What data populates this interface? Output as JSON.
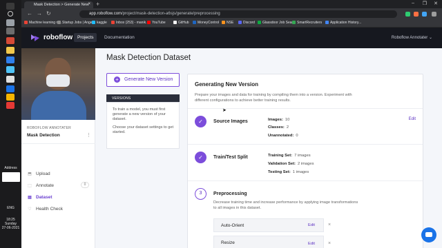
{
  "taskbar": {
    "address_label": "Address",
    "language": "ENG",
    "time": "18:25",
    "day": "Sunday",
    "date": "27-06-2021"
  },
  "browser": {
    "tab_title": "Mask Detection > Generate New",
    "url_host": "app.roboflow.com",
    "url_path": "/project/mask-detection-a6sjs/generate/preprocessing",
    "bookmarks": [
      {
        "label": "Machine learning m...",
        "color": "#ea4335"
      },
      {
        "label": "Startup Jobs | Ange...",
        "color": "#888888"
      },
      {
        "label": "kaggle",
        "color": "#20beff"
      },
      {
        "label": "Inbox (253) - manik...",
        "color": "#ea4335"
      },
      {
        "label": "YouTube",
        "color": "#ff0000"
      },
      {
        "label": "GitHub",
        "color": "#f5f5f5"
      },
      {
        "label": "MoneyControl",
        "color": "#1e66c1"
      },
      {
        "label": "NSE",
        "color": "#f7931e"
      },
      {
        "label": "Discord",
        "color": "#5865f2"
      },
      {
        "label": "Glassdoor Job Sear...",
        "color": "#0caa41"
      },
      {
        "label": "SmartRecruiters",
        "color": "#34a853"
      },
      {
        "label": "Application History...",
        "color": "#4285f4"
      }
    ]
  },
  "app": {
    "brand": "roboflow",
    "nav_projects": "Projects",
    "nav_docs": "Documentation",
    "user": "Roboflow Annotater",
    "accent": "#7c4ddb"
  },
  "sidebar": {
    "kicker": "ROBOFLOW ANNOTATER",
    "project": "Mask Detection",
    "items": [
      {
        "label": "Upload"
      },
      {
        "label": "Annotate",
        "count": "0"
      },
      {
        "label": "Dataset"
      },
      {
        "label": "Health Check"
      }
    ]
  },
  "main": {
    "title": "Mask Detection Dataset",
    "generate_button": "Generate New Version",
    "versions_header": "VERSIONS",
    "versions_p1": "To train a model, you must first generate a new version of your dataset.",
    "versions_p2": "Choose your dataset settings to get started."
  },
  "card": {
    "title": "Generating New Version",
    "description": "Prepare your images and data for training by compiling them into a version. Experiment with different configurations to achieve better training results.",
    "source": {
      "name": "Source Images",
      "edit": "Edit",
      "images_label": "Images:",
      "images": "10",
      "classes_label": "Classes:",
      "classes": "2",
      "unannotated_label": "Unannotated:",
      "unannotated": "0"
    },
    "split": {
      "name": "Train/Test Split",
      "training_label": "Training Set:",
      "training": "7 images",
      "validation_label": "Validation Set:",
      "validation": "2 images",
      "testing_label": "Testing Set:",
      "testing": "1 images"
    },
    "preprocessing": {
      "number": "3",
      "name": "Preprocessing",
      "description": "Decrease training time and increase performance by applying image transformations to all images in this dataset.",
      "options": [
        {
          "label": "Auto-Orient",
          "edit": "Edit"
        },
        {
          "label": "Resize",
          "edit": "Edit"
        }
      ]
    }
  }
}
